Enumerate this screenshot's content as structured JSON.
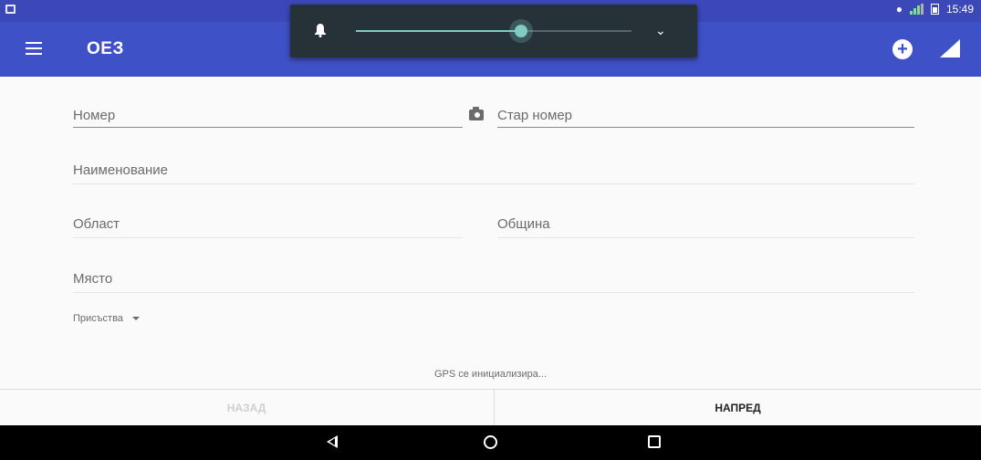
{
  "status_bar": {
    "time": "15:49"
  },
  "app_bar": {
    "title": "ОЕЗ"
  },
  "volume": {
    "level": 0.6
  },
  "form": {
    "number_placeholder": "Номер",
    "old_number_placeholder": "Стар номер",
    "name_placeholder": "Наименование",
    "region_placeholder": "Област",
    "municipality_placeholder": "Община",
    "place_placeholder": "Място",
    "presence_select": "Присъства"
  },
  "gps_status": "GPS се инициализира...",
  "nav": {
    "back_label": "НАЗАД",
    "next_label": "НАПРЕД"
  },
  "colors": {
    "app_bar": "#3f51c7",
    "status_bar": "#3c48b8",
    "accent": "#80cbc4"
  }
}
